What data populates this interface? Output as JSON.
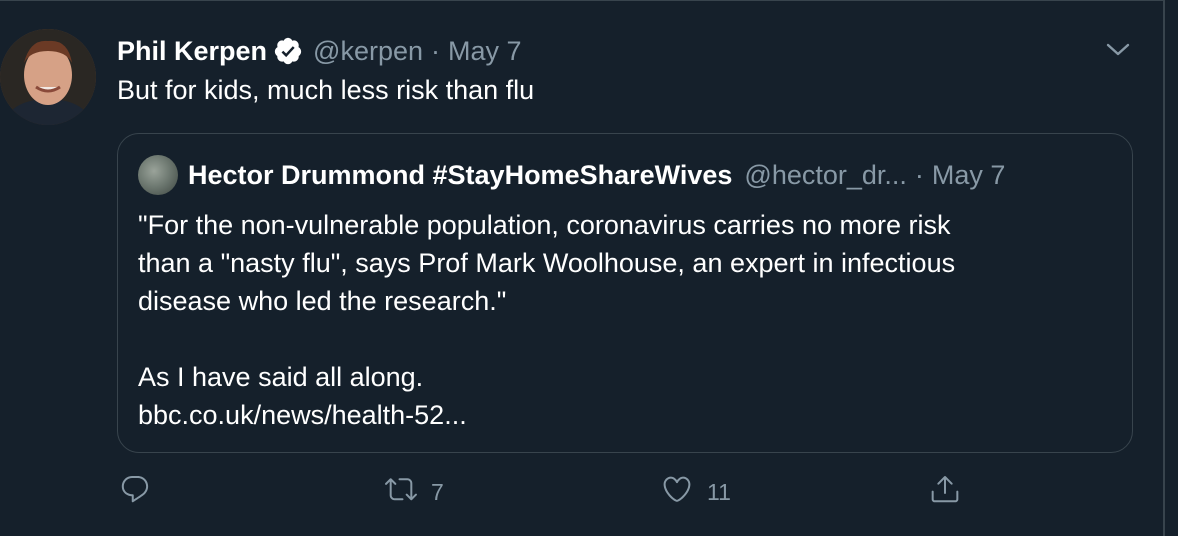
{
  "tweet": {
    "author_name": "Phil Kerpen",
    "handle": "@kerpen",
    "separator": "·",
    "date": "May 7",
    "text": "But for kids, much less risk than flu",
    "verified_icon": "verified-badge-icon",
    "menu_icon": "chevron-down-icon"
  },
  "quoted": {
    "author_name": "Hector Drummond #StayHomeShareWives",
    "handle": "@hector_dr...",
    "separator": "·",
    "date": "May 7",
    "line1": "\"For the non-vulnerable population, coronavirus carries no more risk",
    "line2": "than a \"nasty flu\", says Prof Mark Woolhouse, an expert in infectious",
    "line3": "disease who led the research.\"",
    "line4": "As I have said all along.",
    "link": "bbc.co.uk/news/health-52..."
  },
  "actions": {
    "reply_icon": "reply-icon",
    "retweet_icon": "retweet-icon",
    "retweet_count": "7",
    "like_icon": "heart-icon",
    "like_count": "11",
    "share_icon": "share-icon"
  },
  "colors": {
    "background": "#15202b",
    "secondary_text": "#8899a6",
    "border": "#38444d",
    "verified": "#ffffff"
  }
}
